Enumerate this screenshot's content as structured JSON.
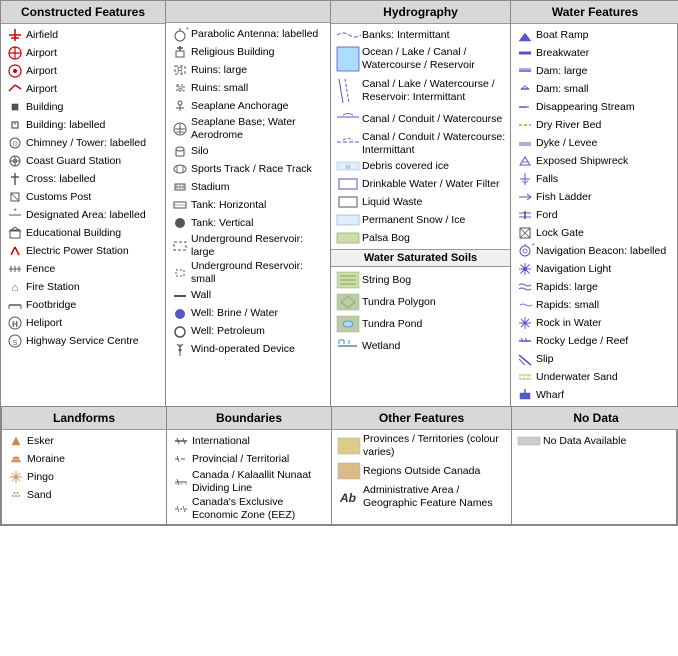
{
  "sections": {
    "constructed": {
      "header": "Constructed Features",
      "col1": [
        {
          "icon": "airfield",
          "label": "Airfield"
        },
        {
          "icon": "airport-circle-cross",
          "label": "Airport"
        },
        {
          "icon": "airport-circle-dot",
          "label": "Airport"
        },
        {
          "icon": "airport-line",
          "label": "Airport"
        },
        {
          "icon": "building-sq",
          "label": "Building"
        },
        {
          "icon": "building-labelled",
          "label": "Building: labelled"
        },
        {
          "icon": "chimney",
          "label": "Chimney / Tower: labelled"
        },
        {
          "icon": "coast-guard",
          "label": "Coast Guard Station"
        },
        {
          "icon": "cross-labelled",
          "label": "Cross: labelled"
        },
        {
          "icon": "customs",
          "label": "Customs Post"
        },
        {
          "icon": "designated",
          "label": "Designated Area: labelled"
        },
        {
          "icon": "educational",
          "label": "Educational Building"
        },
        {
          "icon": "electric",
          "label": "Electric Power Station"
        },
        {
          "icon": "fence",
          "label": "Fence"
        },
        {
          "icon": "fire-station",
          "label": "Fire Station"
        },
        {
          "icon": "footbridge",
          "label": "Footbridge"
        },
        {
          "icon": "heliport",
          "label": "Heliport"
        },
        {
          "icon": "highway-service",
          "label": "Highway Service Centre"
        }
      ],
      "col2": [
        {
          "icon": "parabolic",
          "label": "Parabolic Antenna: labelled"
        },
        {
          "icon": "religious",
          "label": "Religious Building"
        },
        {
          "icon": "ruins-large",
          "label": "Ruins: large"
        },
        {
          "icon": "ruins-small",
          "label": "Ruins: small"
        },
        {
          "icon": "seaplane-anchor",
          "label": "Seaplane Anchorage"
        },
        {
          "icon": "seaplane-base",
          "label": "Seaplane Base; Water Aerodrome"
        },
        {
          "icon": "silo",
          "label": "Silo"
        },
        {
          "icon": "sports-track",
          "label": "Sports Track / Race Track"
        },
        {
          "icon": "stadium",
          "label": "Stadium"
        },
        {
          "icon": "tank-h",
          "label": "Tank: Horizontal"
        },
        {
          "icon": "tank-v",
          "label": "Tank: Vertical"
        },
        {
          "icon": "underground-large",
          "label": "Underground Reservoir: large"
        },
        {
          "icon": "underground-small",
          "label": "Underground Reservoir: small"
        },
        {
          "icon": "wall",
          "label": "Wall"
        },
        {
          "icon": "well-brine",
          "label": "Well: Brine / Water"
        },
        {
          "icon": "well-petro",
          "label": "Well: Petroleum"
        },
        {
          "icon": "wind-device",
          "label": "Wind-operated Device"
        }
      ]
    },
    "hydrography": {
      "header": "Hydrography",
      "items": [
        {
          "icon": "banks",
          "label": "Banks: Intermittant"
        },
        {
          "icon": "ocean-lake",
          "label": "Ocean / Lake / Canal / Watercourse / Reservoir"
        },
        {
          "icon": "canal-inter",
          "label": "Canal / Lake / Watercourse / Reservoir: Intermittant"
        },
        {
          "icon": "canal-conduit",
          "label": "Canal / Conduit / Watercourse"
        },
        {
          "icon": "canal-conduit-inter",
          "label": "Canal / Conduit / Watercourse: Intermittant"
        },
        {
          "icon": "debris-ice",
          "label": "Debris covered ice"
        },
        {
          "icon": "drinkable",
          "label": "Drinkable Water / Water Filter"
        },
        {
          "icon": "liquid-waste",
          "label": "Liquid Waste"
        },
        {
          "icon": "perm-snow",
          "label": "Permanent Snow / Ice"
        },
        {
          "icon": "palsa-bog",
          "label": "Palsa Bog"
        }
      ],
      "water_saturated": {
        "header": "Water Saturated Soils",
        "items": [
          {
            "icon": "string-bog",
            "label": "String Bog"
          },
          {
            "icon": "tundra-poly",
            "label": "Tundra Polygon"
          },
          {
            "icon": "tundra-pond",
            "label": "Tundra Pond"
          },
          {
            "icon": "wetland",
            "label": "Wetland"
          }
        ]
      }
    },
    "water_features": {
      "header": "Water Features",
      "items": [
        {
          "icon": "boat-ramp",
          "label": "Boat Ramp"
        },
        {
          "icon": "breakwater",
          "label": "Breakwater"
        },
        {
          "icon": "dam-large",
          "label": "Dam: large"
        },
        {
          "icon": "dam-small",
          "label": "Dam: small"
        },
        {
          "icon": "disappearing",
          "label": "Disappearing Stream"
        },
        {
          "icon": "dry-river",
          "label": "Dry River Bed"
        },
        {
          "icon": "dyke",
          "label": "Dyke / Levee"
        },
        {
          "icon": "shipwreck",
          "label": "Exposed Shipwreck"
        },
        {
          "icon": "falls",
          "label": "Falls"
        },
        {
          "icon": "fish-ladder",
          "label": "Fish Ladder"
        },
        {
          "icon": "ford",
          "label": "Ford"
        },
        {
          "icon": "lock-gate",
          "label": "Lock Gate"
        },
        {
          "icon": "nav-beacon",
          "label": "Navigation Beacon: labelled"
        },
        {
          "icon": "nav-light",
          "label": "Navigation Light"
        },
        {
          "icon": "rapids-large",
          "label": "Rapids: large"
        },
        {
          "icon": "rapids-small",
          "label": "Rapids: small"
        },
        {
          "icon": "rock-water",
          "label": "Rock in Water"
        },
        {
          "icon": "rocky-ledge",
          "label": "Rocky Ledge / Reef"
        },
        {
          "icon": "slip",
          "label": "Slip"
        },
        {
          "icon": "underwater-sand",
          "label": "Underwater Sand"
        },
        {
          "icon": "wharf",
          "label": "Wharf"
        }
      ]
    }
  },
  "bottom": {
    "landforms": {
      "header": "Landforms",
      "items": [
        {
          "icon": "esker",
          "label": "Esker"
        },
        {
          "icon": "moraine",
          "label": "Moraine"
        },
        {
          "icon": "pingo",
          "label": "Pingo"
        },
        {
          "icon": "sand",
          "label": "Sand"
        }
      ]
    },
    "boundaries": {
      "header": "Boundaries",
      "items": [
        {
          "icon": "international",
          "label": "International"
        },
        {
          "icon": "provincial",
          "label": "Provincial / Territorial"
        },
        {
          "icon": "canada-kala",
          "label": "Canada / Kalaallit Nunaat Dividing Line"
        },
        {
          "icon": "eez",
          "label": "Canada's Exclusive Economic Zone (EEZ)"
        }
      ]
    },
    "other": {
      "header": "Other Features",
      "items": [
        {
          "icon": "provinces",
          "label": "Provinces / Territories (colour varies)"
        },
        {
          "icon": "regions-outside",
          "label": "Regions Outside Canada"
        },
        {
          "icon": "admin-area",
          "label": "Administrative Area / Geographic Feature Names"
        }
      ]
    },
    "no_data": {
      "header": "No Data",
      "items": [
        {
          "icon": "no-data",
          "label": "No Data Available"
        }
      ]
    }
  }
}
